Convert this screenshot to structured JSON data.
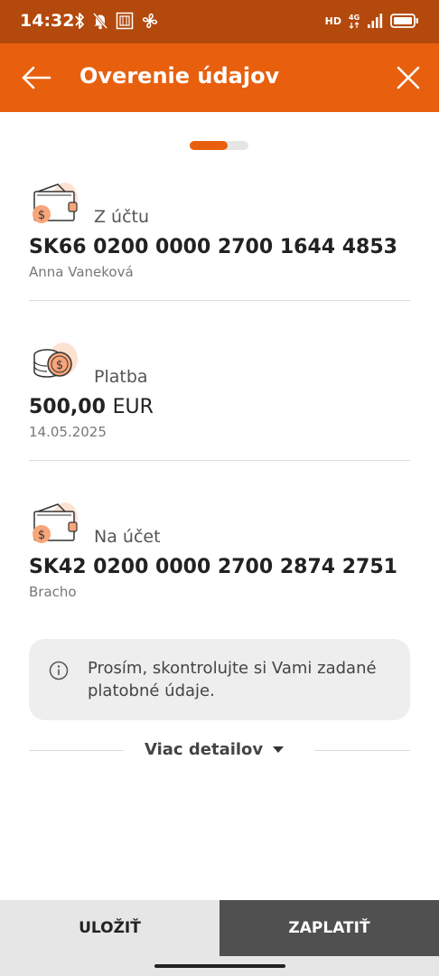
{
  "status_bar": {
    "time": "14:32",
    "network_label": "HD",
    "icons_left": [
      "bluetooth-icon",
      "muted-bell-icon",
      "app-notification-icon",
      "fan-icon"
    ],
    "icons_right": [
      "cellular-4g-icon",
      "signal-icon",
      "battery-icon"
    ]
  },
  "header": {
    "title": "Overenie údajov",
    "back_icon": "arrow-left-icon",
    "close_icon": "close-icon",
    "background_color": "#e8600e"
  },
  "progress": {
    "step": 1,
    "of": 2,
    "fraction": 0.65,
    "color": "#e8600e"
  },
  "from_account": {
    "label": "Z účtu",
    "iban": "SK66 0200 0000 2700 1644 4853",
    "owner": "Anna Vaneková",
    "icon": "wallet-icon"
  },
  "payment": {
    "label": "Platba",
    "amount": "500,00",
    "currency": "EUR",
    "date": "14.05.2025",
    "icon": "coins-icon"
  },
  "to_account": {
    "label": "Na účet",
    "iban": "SK42 0200 0000 2700 2874 2751",
    "owner": "Bracho",
    "icon": "wallet-icon"
  },
  "info": {
    "text": "Prosím, skontrolujte si Vami zadané platobné údaje.",
    "icon": "info-icon"
  },
  "details": {
    "label": "Viac detailov",
    "icon": "caret-down-icon"
  },
  "actions": {
    "save_label": "ULOŽIŤ",
    "pay_label": "ZAPLATIŤ"
  }
}
